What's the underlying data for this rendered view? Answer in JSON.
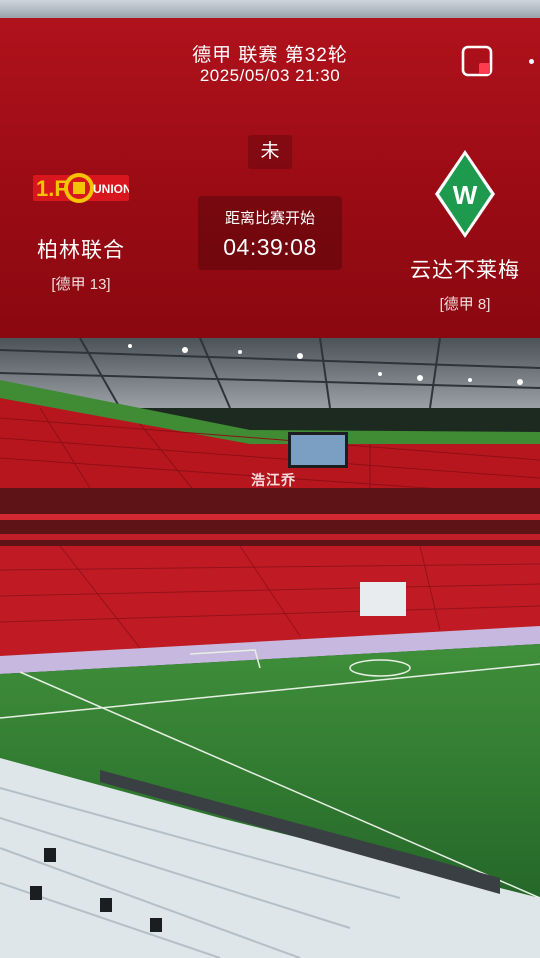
{
  "header": {
    "title": "德甲 联赛 第32轮",
    "datetime": "2025/05/03 21:30"
  },
  "status": "未",
  "countdown": {
    "label": "距离比赛开始",
    "time": "04:39:08"
  },
  "home_team": {
    "name": "柏林联合",
    "rank": "[德甲 13]",
    "logo_text": "UNION"
  },
  "away_team": {
    "name": "云达不莱梅",
    "rank": "[德甲 8]"
  },
  "photo": {
    "watermark": "浩江乔"
  },
  "colors": {
    "panel_red": "#a50f18",
    "union_red": "#d8161d",
    "union_yellow": "#f5c400",
    "werder_green": "#1d9a4d"
  },
  "icons": {
    "mini_window": "picture-in-picture-icon",
    "more": "more-icon"
  }
}
